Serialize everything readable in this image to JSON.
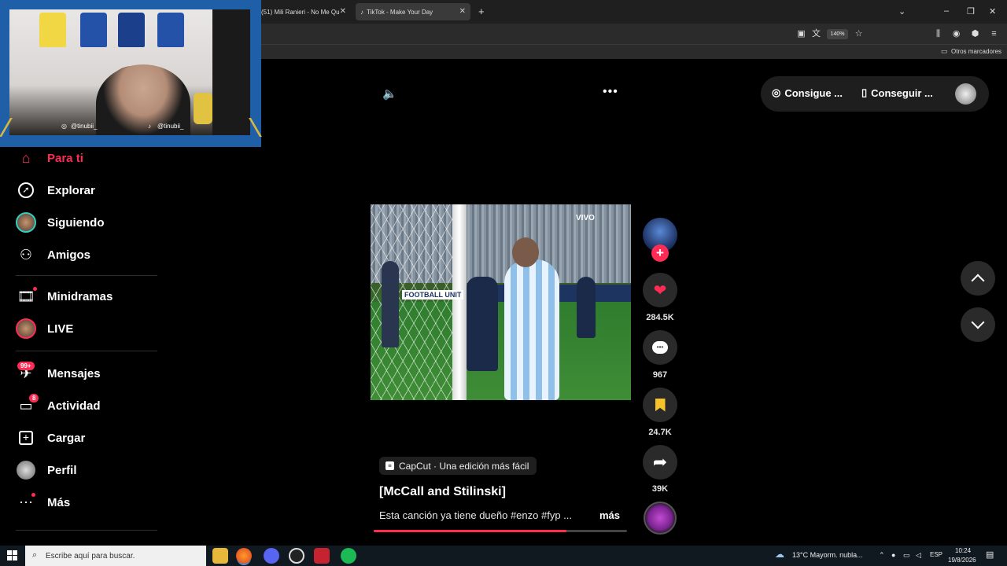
{
  "browser": {
    "tabs": [
      {
        "title": "(51) Mili Ranieri - No Me Qu",
        "active": false
      },
      {
        "title": "TikTok - Make Your Day",
        "active": true
      }
    ],
    "zoom": "140%",
    "bookmarks_label": "Otros marcadores"
  },
  "webcam": {
    "handle_instagram": "@tinubii_",
    "handle_tiktok": "@tinubii_"
  },
  "sidebar": {
    "items": [
      {
        "label": "Para ti",
        "icon": "home-icon",
        "active": true
      },
      {
        "label": "Explorar",
        "icon": "compass-icon"
      },
      {
        "label": "Siguiendo",
        "icon": "following-avatar-icon"
      },
      {
        "label": "Amigos",
        "icon": "friends-icon"
      },
      {
        "label": "Minidramas",
        "icon": "film-icon"
      },
      {
        "label": "LIVE",
        "icon": "live-avatar-icon"
      },
      {
        "label": "Mensajes",
        "icon": "messages-icon",
        "badge": "99+"
      },
      {
        "label": "Actividad",
        "icon": "activity-icon",
        "badge": "8"
      },
      {
        "label": "Cargar",
        "icon": "upload-icon"
      },
      {
        "label": "Perfil",
        "icon": "profile-avatar-icon"
      },
      {
        "label": "Más",
        "icon": "more-dots-icon"
      }
    ]
  },
  "topright": {
    "btn1": "Consigue ...",
    "btn2": "Conseguir ..."
  },
  "video": {
    "live_label": "VIVO",
    "board_text": "FOOTBALL UNIT",
    "progress": 0.76
  },
  "actions": {
    "likes": "284.5K",
    "comments": "967",
    "saves": "24.7K",
    "shares": "39K"
  },
  "caption": {
    "promo": "CapCut · Una edición más fácil",
    "title": "[McCall and Stilinski]",
    "description": "Esta canción ya tiene dueño #enzo #fyp ...",
    "more": "más"
  },
  "taskbar": {
    "search_placeholder": "Escribe aquí para buscar.",
    "weather": "13°C  Mayorm. nubla...",
    "lang": "ESP",
    "time": "10:24",
    "date": "19/8/2026"
  },
  "colors": {
    "accent": "#fe2c55",
    "background": "#000000"
  }
}
